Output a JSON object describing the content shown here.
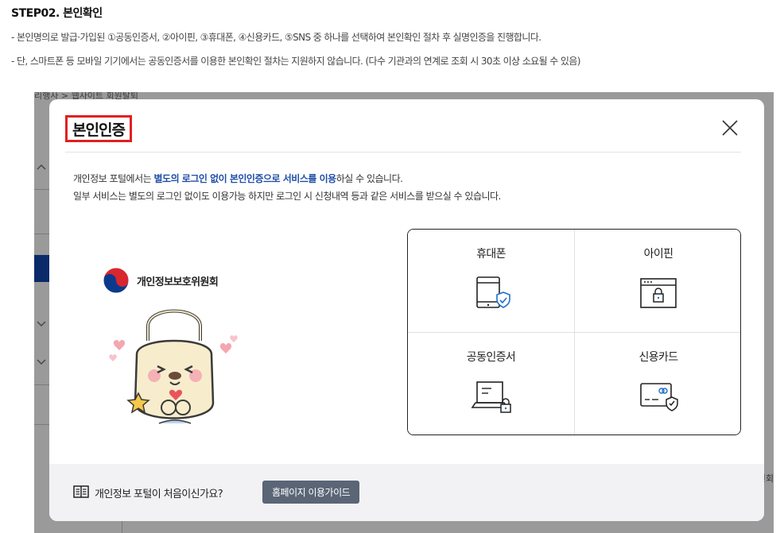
{
  "step": {
    "title": "STEP02. 본인확인",
    "line1": "- 본인명의로 발급·가입된 ①공동인증서, ②아이핀, ③휴대폰, ④신용카드, ⑤SNS 중 하나를 선택하여 본인확인 절차 후 실명인증을 진행합니다.",
    "line2": "- 단, 스마트폰 등 모바일 기기에서는 공동인증서를 이용한 본인확인 절차는 지원하지 않습니다. (다수 기관과의 연계로 조회 시 30초 이상 소요될 수 있음)"
  },
  "background": {
    "breadcrumb": "리행사 > 웹사이트 회원탈퇴",
    "right_text": "인회"
  },
  "modal": {
    "title": "본인인증",
    "close_icon": "close-icon",
    "intro_pre": "개인정보 포털에서는 ",
    "intro_highlight": "별도의 로그인 없이 본인인증으로 서비스를 이용",
    "intro_post": "하실 수 있습니다.",
    "intro_line2": "일부 서비스는 별도의 로그인 없이도 이용가능 하지만 로그인 시 신청내역 등과 같은 서비스를 받으실 수 있습니다.",
    "logo_text": "개인정보보호위원회",
    "options": [
      {
        "label": "휴대폰",
        "icon": "mobile-phone-icon"
      },
      {
        "label": "아이핀",
        "icon": "ipin-window-icon"
      },
      {
        "label": "공동인증서",
        "icon": "certificate-laptop-icon"
      },
      {
        "label": "신용카드",
        "icon": "credit-card-icon"
      }
    ],
    "footer_text": "개인정보 포털이 처음이신가요?",
    "guide_button": "홈페이지 이용가이드"
  },
  "colors": {
    "accent_blue": "#1f4ea8",
    "title_outline": "#e02020",
    "guide_button_bg": "#5a6576"
  }
}
